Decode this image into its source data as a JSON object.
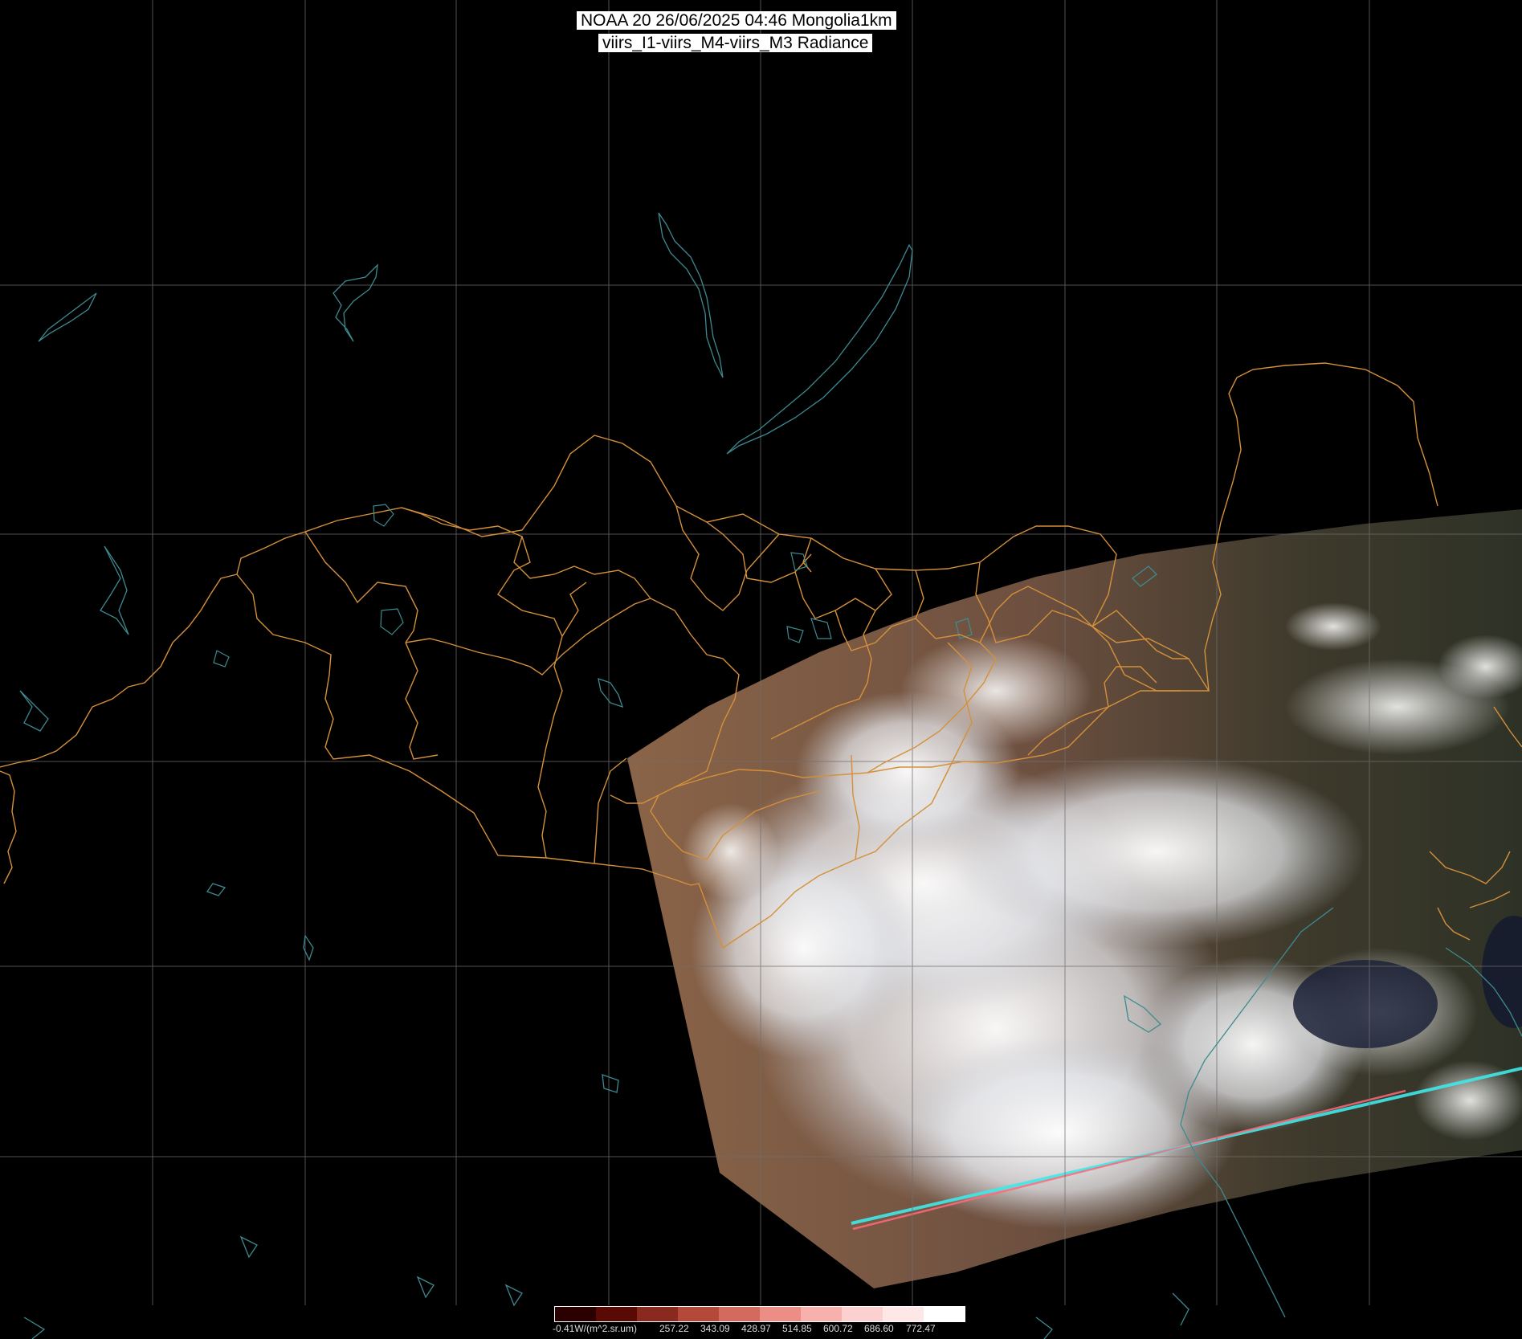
{
  "title": {
    "line1": "NOAA 20 26/06/2025 04:46 Mongolia1km",
    "line2": "viirs_I1-viirs_M4-viirs_M3 Radiance"
  },
  "colorbar": {
    "min_label": "-0.41W/(m^2.sr.um)",
    "tick_labels": [
      "257.22",
      "343.09",
      "428.97",
      "514.85",
      "600.72",
      "686.60",
      "772.47"
    ],
    "colors": [
      "#2a0000",
      "#5a0a05",
      "#8a2a1e",
      "#b4493a",
      "#d46a5e",
      "#ec8e86",
      "#f8b0ac",
      "#fcd0ce",
      "#fee8e7",
      "#ffffff"
    ]
  },
  "colors": {
    "background": "#000000",
    "gridline": "#6e6e6e",
    "coastline": "#3d8a90",
    "border": "#d4903a",
    "swath_land": "#7a5a44",
    "swath_cloud": "#eef0f4"
  }
}
